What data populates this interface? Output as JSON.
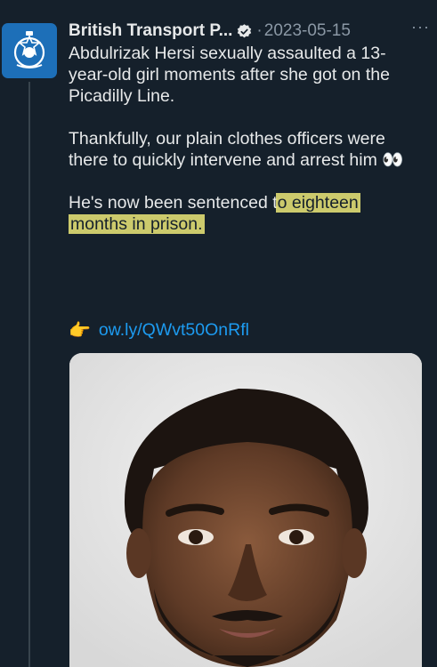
{
  "tweet": {
    "author_name": "British Transport P...",
    "verified_icon": "verified-badge-icon",
    "separator": "·",
    "date": "2023-05-15",
    "more_label": "···",
    "text": {
      "p1": "Abdulrizak Hersi sexually assaulted a 13-year-old girl moments after she got on the Picadilly Line.",
      "p2": "Thankfully, our plain clothes officers were there to quickly intervene and arrest him",
      "p2_emoji": "👀",
      "p3_before": "He's now been sentenced t",
      "p3_highlight_1": "o eighteen",
      "p3_highlight_2": "months in prison."
    },
    "link_icon": "pointing-hand-icon",
    "link_text": "ow.ly/QWvt50OnRfl",
    "media": {
      "description_icon": "mugshot-photo"
    }
  },
  "colors": {
    "background": "#15202b",
    "text": "#e7e9ea",
    "muted": "#8b98a5",
    "link": "#1d9bf0",
    "highlight": "#ece878",
    "verified": "#e7e9ea"
  }
}
